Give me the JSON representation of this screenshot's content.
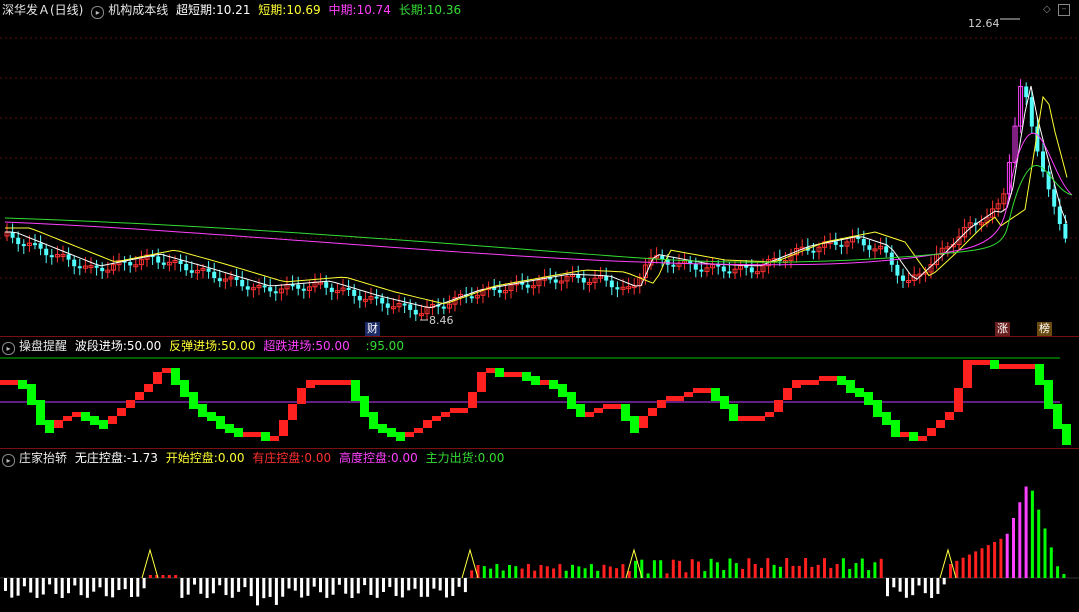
{
  "main": {
    "stock_title": "深华发Ａ(日线)",
    "indicator_name": "机构成本线",
    "ultra_label": "超短期:",
    "ultra_value": "10.21",
    "ultra_color": "#ffffff",
    "short_label": "短期:",
    "short_value": "10.69",
    "short_color": "#ffff33",
    "mid_label": "中期:",
    "mid_value": "10.74",
    "mid_color": "#ff40ff",
    "long_label": "长期:",
    "long_value": "10.36",
    "long_color": "#33dd33",
    "high_mark": "12.64",
    "low_mark": "8.46",
    "tag_cai": "财",
    "tag_zhang": "涨",
    "tag_bang": "榜",
    "corner_icon_1": "diamond-icon",
    "corner_icon_2": "minimize-icon",
    "up_color": "#ff3232",
    "down_color": "#54ffff",
    "limit_color": "#ff40ff"
  },
  "osc": {
    "name": "操盘提醒",
    "wave_label": "波段进场:",
    "wave_value": "50.00",
    "rebound_label": "反弹进场:",
    "rebound_value": "50.00",
    "oversold_label": "超跌进场:",
    "oversold_value": "50.00",
    "top_label": ":",
    "top_value": "95.00",
    "rise_color": "#ff2020",
    "fall_color": "#00ff00",
    "midline_color": "#c040ff",
    "topline_color": "#00c000"
  },
  "vol": {
    "name": "庄家抬轿",
    "none_label": "无庄控盘:",
    "none_value": "-1.73",
    "start_label": "开始控盘:",
    "start_value": "0.00",
    "has_label": "有庄控盘:",
    "has_value": "0.00",
    "high_label": "高度控盘:",
    "high_value": "0.00",
    "out_label": "主力出货:",
    "out_value": "0.00",
    "colors": {
      "white": "#ffffff",
      "yellow": "#ffff40",
      "red": "#ff2020",
      "magenta": "#ff40ff",
      "green": "#00ff00"
    }
  }
}
